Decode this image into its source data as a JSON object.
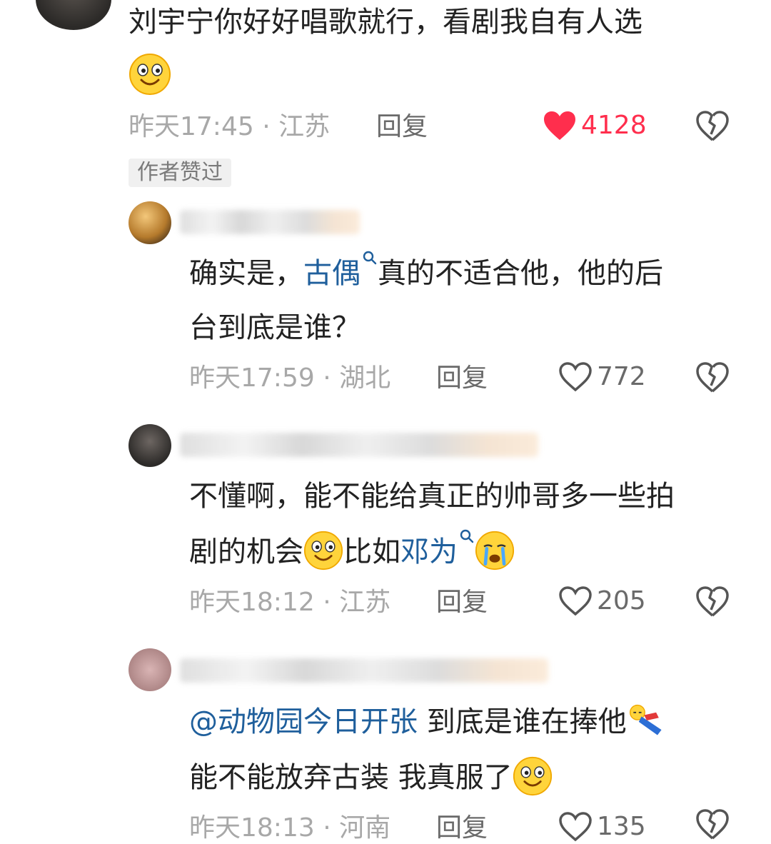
{
  "comments": [
    {
      "text_part1": "刘宇宁你好好唱歌就行，看剧我自有人选",
      "emoji": "smiling-emoji",
      "time": "昨天17:45",
      "sep": "·",
      "location": "江苏",
      "reply_label": "回复",
      "likes": "4128",
      "liked": true,
      "badge": "作者赞过"
    },
    {
      "text_prefix": "确实是，",
      "link": "古偶",
      "text_after_link": "真的不适合他，他的后",
      "text_line2": "台到底是谁？",
      "time": "昨天17:59",
      "sep": "·",
      "location": "湖北",
      "reply_label": "回复",
      "likes": "772"
    },
    {
      "text_line1": "不懂啊，能不能给真正的帅哥多一些拍",
      "text_line2a": "剧的机会",
      "text_line2b": "比如",
      "link": "邓为",
      "time": "昨天18:12",
      "sep": "·",
      "location": "江苏",
      "reply_label": "回复",
      "likes": "205"
    },
    {
      "mention": "@动物园今日开张",
      "text_after_mention": " 到底是谁在捧他",
      "text_line2": "能不能放弃古装 我真服了",
      "time": "昨天18:13",
      "sep": "·",
      "location": "河南",
      "reply_label": "回复",
      "likes": "135"
    }
  ],
  "colors": {
    "like_red": "#ff2e4d",
    "link_blue": "#1f5f9c",
    "meta_gray": "#a8a8a8"
  }
}
